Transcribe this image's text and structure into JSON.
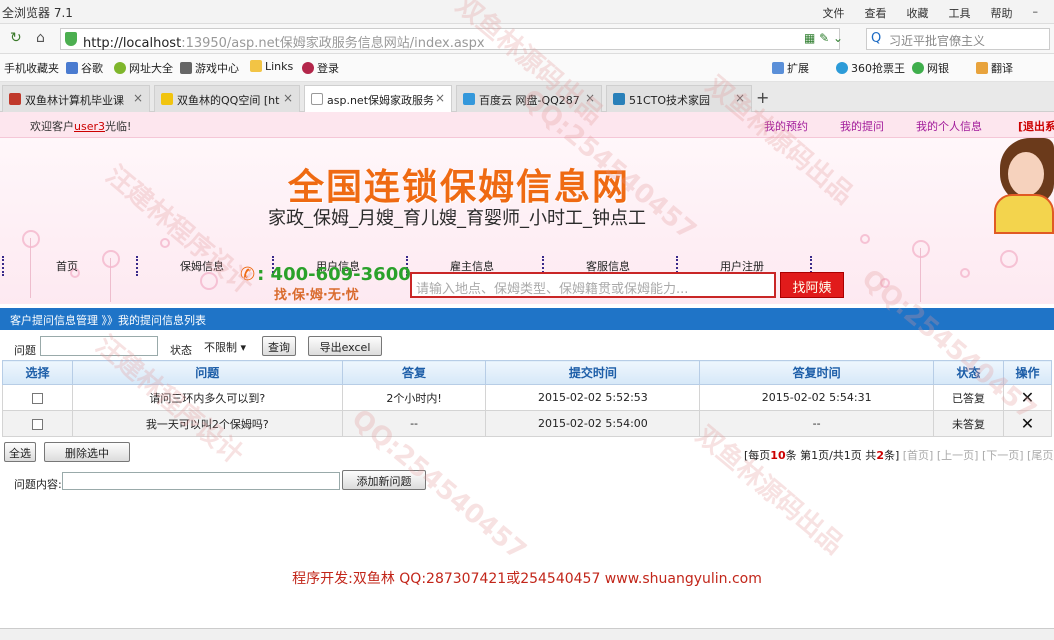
{
  "browser": {
    "app_title": "全浏览器 7.1",
    "menu": [
      "文件",
      "查看",
      "收藏",
      "工具",
      "帮助"
    ],
    "url_host": "http://localhost",
    "url_rest": ":13950/asp.net保姆家政服务信息网站/index.aspx",
    "search_placeholder": "习近平批官僚主义",
    "bookmarks": [
      "手机收藏夹",
      "谷歌",
      "网址大全",
      "游戏中心",
      "Links",
      "登录",
      "扩展",
      "360抢票王",
      "网银",
      "翻译"
    ],
    "tabs": [
      {
        "label": "双鱼林计算机毕业课",
        "color": "#c0392b"
      },
      {
        "label": "双鱼林的QQ空间 [ht",
        "color": "#f1c40f"
      },
      {
        "label": "asp.net保姆家政服务",
        "color": "#ffffff"
      },
      {
        "label": "百度云 网盘-QQ287",
        "color": "#3498db"
      },
      {
        "label": "51CTO技术家园",
        "color": "#2980b9"
      }
    ],
    "tab_add": "+"
  },
  "header": {
    "welcome_prefix": "欢迎客户",
    "username": "user3",
    "welcome_suffix": "光临!",
    "links": [
      "我的预约",
      "我的提问",
      "我的个人信息"
    ],
    "logout": "[退出系"
  },
  "banner": {
    "title": "全国连锁保姆信息网",
    "subtitle": "家政_保姆_月嫂_育儿嫂_育婴师_小时工_钟点工",
    "nav": [
      "首页",
      "保姆信息",
      "用户信息",
      "雇主信息",
      "客服信息",
      "用户注册"
    ],
    "phone": ": 400-609-3600",
    "phone_slogan": "找·保·姆·无·忧",
    "search_placeholder": "请输入地点、保姆类型、保姆籍贯或保姆能力...",
    "search_button": "找阿姨"
  },
  "section": {
    "breadcrumb": "客户提问信息管理 》》我的提问信息列表"
  },
  "filter": {
    "question_label": "问题",
    "status_label": "状态",
    "status_value": "不限制",
    "query_button": "查询",
    "export_button": "导出excel"
  },
  "table": {
    "headers": [
      "选择",
      "问题",
      "答复",
      "提交时间",
      "答复时间",
      "状态",
      "操作"
    ],
    "rows": [
      {
        "question": "请问三环内多久可以到?",
        "answer": "2个小时内!",
        "submit_time": "2015-02-02 5:52:53",
        "answer_time": "2015-02-02 5:54:31",
        "status": "已答复"
      },
      {
        "question": "我一天可以叫2个保姆吗?",
        "answer": "--",
        "submit_time": "2015-02-02 5:54:00",
        "answer_time": "--",
        "status": "未答复"
      }
    ]
  },
  "batch": {
    "select_all": "全选",
    "delete_selected": "删除选中",
    "pager_prefix": "[每页",
    "page_size": "10",
    "pager_mid": "条 第1页/共1页 共",
    "total": "2",
    "pager_end": "条]",
    "first": "[首页]",
    "prev": "[上一页]",
    "next": "[下一页]",
    "last": "[尾页]"
  },
  "add_question": {
    "label": "问题内容:",
    "button": "添加新问题"
  },
  "footer": {
    "text": "程序开发:双鱼林 QQ:287307421或254540457 www.shuangyulin.com"
  },
  "watermarks": [
    "双鱼林源码出品",
    "QQ:254540457",
    "汪建林程序设计",
    "双鱼林源码出品",
    "QQ:254540457",
    "汪建林程序设计",
    "双鱼林源码出品",
    "QQ:254540457"
  ]
}
